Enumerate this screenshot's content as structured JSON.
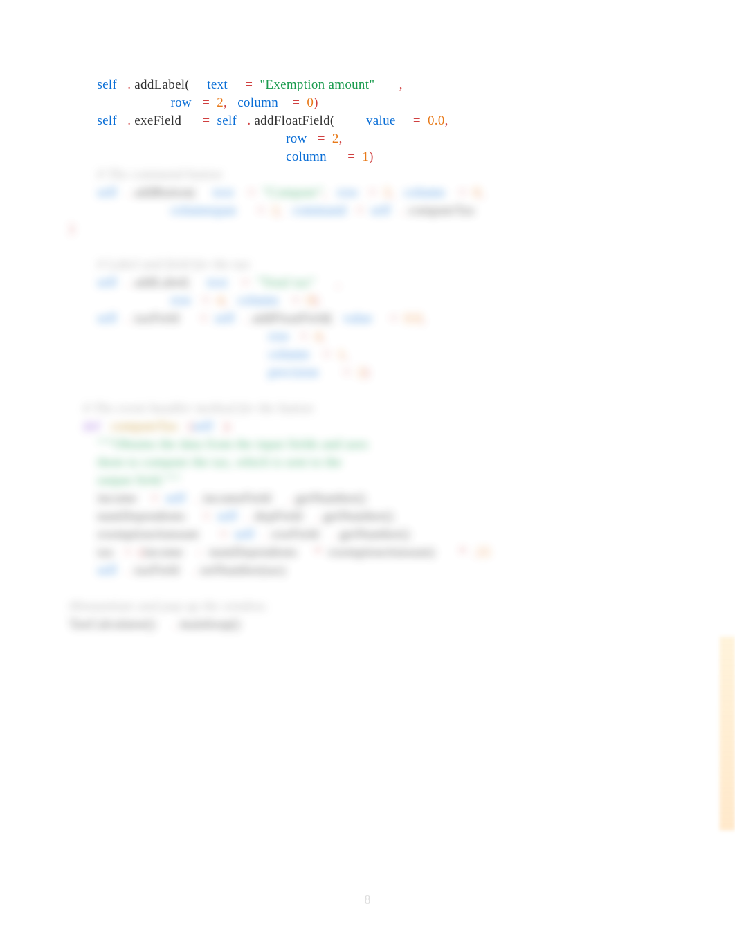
{
  "clear_lines": [
    {
      "indent": "        ",
      "tokens": [
        {
          "cls": "kw",
          "t": "self"
        },
        {
          "cls": "op",
          "t": "   . "
        },
        {
          "cls": "plain",
          "t": "addLabel("
        },
        {
          "cls": "plain",
          "t": "     "
        },
        {
          "cls": "kw",
          "t": "text"
        },
        {
          "cls": "plain",
          "t": "     "
        },
        {
          "cls": "op",
          "t": "=  "
        },
        {
          "cls": "str",
          "t": "\"Exemption amount\""
        },
        {
          "cls": "plain",
          "t": "       "
        },
        {
          "cls": "op",
          "t": ","
        }
      ]
    },
    {
      "indent": "                             ",
      "tokens": [
        {
          "cls": "kw",
          "t": "row"
        },
        {
          "cls": "plain",
          "t": "   "
        },
        {
          "cls": "op",
          "t": "=  "
        },
        {
          "cls": "num",
          "t": "2"
        },
        {
          "cls": "op",
          "t": ",   "
        },
        {
          "cls": "kw",
          "t": "column"
        },
        {
          "cls": "plain",
          "t": "    "
        },
        {
          "cls": "op",
          "t": "=  "
        },
        {
          "cls": "num",
          "t": "0"
        },
        {
          "cls": "op",
          "t": ")"
        }
      ]
    },
    {
      "indent": "        ",
      "tokens": [
        {
          "cls": "kw",
          "t": "self"
        },
        {
          "cls": "op",
          "t": "   . "
        },
        {
          "cls": "plain",
          "t": "exeField      "
        },
        {
          "cls": "op",
          "t": "=  "
        },
        {
          "cls": "kw",
          "t": "self"
        },
        {
          "cls": "op",
          "t": "   . "
        },
        {
          "cls": "plain",
          "t": "addFloatField("
        },
        {
          "cls": "plain",
          "t": "         "
        },
        {
          "cls": "kw",
          "t": "value"
        },
        {
          "cls": "plain",
          "t": "     "
        },
        {
          "cls": "op",
          "t": "=  "
        },
        {
          "cls": "num",
          "t": "0.0"
        },
        {
          "cls": "op",
          "t": ", "
        }
      ]
    },
    {
      "indent": "                                                              ",
      "tokens": [
        {
          "cls": "kw",
          "t": "row"
        },
        {
          "cls": "plain",
          "t": "   "
        },
        {
          "cls": "op",
          "t": "=  "
        },
        {
          "cls": "num",
          "t": "2"
        },
        {
          "cls": "op",
          "t": ","
        }
      ]
    },
    {
      "indent": "                                                              ",
      "tokens": [
        {
          "cls": "kw",
          "t": "column"
        },
        {
          "cls": "plain",
          "t": "      "
        },
        {
          "cls": "op",
          "t": "=  "
        },
        {
          "cls": "num",
          "t": "1"
        },
        {
          "cls": "op",
          "t": ")"
        }
      ]
    }
  ],
  "blur_lines": [
    {
      "indent": "        ",
      "tokens": [
        {
          "cls": "com",
          "t": "# The command button"
        }
      ]
    },
    {
      "indent": "        ",
      "tokens": [
        {
          "cls": "kw",
          "t": "self"
        },
        {
          "cls": "op",
          "t": "   . "
        },
        {
          "cls": "plain",
          "t": "addButton(     "
        },
        {
          "cls": "kw",
          "t": "text"
        },
        {
          "cls": "plain",
          "t": "    "
        },
        {
          "cls": "op",
          "t": "=  "
        },
        {
          "cls": "str",
          "t": "\"Compute\""
        },
        {
          "cls": "op",
          "t": ",   "
        },
        {
          "cls": "kw",
          "t": "row"
        },
        {
          "cls": "plain",
          "t": "   "
        },
        {
          "cls": "op",
          "t": "=  "
        },
        {
          "cls": "num",
          "t": "3"
        },
        {
          "cls": "op",
          "t": ",   "
        },
        {
          "cls": "kw",
          "t": "column"
        },
        {
          "cls": "plain",
          "t": "    "
        },
        {
          "cls": "op",
          "t": "=  "
        },
        {
          "cls": "num",
          "t": "0"
        },
        {
          "cls": "op",
          "t": ","
        }
      ]
    },
    {
      "indent": "                             ",
      "tokens": [
        {
          "cls": "kw",
          "t": "columnspan"
        },
        {
          "cls": "plain",
          "t": "      "
        },
        {
          "cls": "op",
          "t": "=  "
        },
        {
          "cls": "num",
          "t": "2"
        },
        {
          "cls": "op",
          "t": ",   "
        },
        {
          "cls": "kw",
          "t": "command"
        },
        {
          "cls": "plain",
          "t": "   "
        },
        {
          "cls": "op",
          "t": "=  "
        },
        {
          "cls": "kw",
          "t": "self"
        },
        {
          "cls": "op",
          "t": "   . "
        },
        {
          "cls": "plain",
          "t": "computeTax"
        }
      ]
    },
    {
      "indent": "",
      "tokens": [
        {
          "cls": "op",
          "t": ")"
        }
      ]
    },
    {
      "indent": "",
      "tokens": [
        {
          "cls": "plain",
          "t": " "
        }
      ]
    },
    {
      "indent": "        ",
      "tokens": [
        {
          "cls": "com",
          "t": "# Label and field for the tax"
        }
      ]
    },
    {
      "indent": "        ",
      "tokens": [
        {
          "cls": "kw",
          "t": "self"
        },
        {
          "cls": "op",
          "t": "   . "
        },
        {
          "cls": "plain",
          "t": "addLabel(     "
        },
        {
          "cls": "kw",
          "t": "text"
        },
        {
          "cls": "plain",
          "t": "    "
        },
        {
          "cls": "op",
          "t": "=  "
        },
        {
          "cls": "str",
          "t": "\"Total tax\""
        },
        {
          "cls": "plain",
          "t": "      "
        },
        {
          "cls": "op",
          "t": ","
        }
      ]
    },
    {
      "indent": "                             ",
      "tokens": [
        {
          "cls": "kw",
          "t": "row"
        },
        {
          "cls": "plain",
          "t": "   "
        },
        {
          "cls": "op",
          "t": "=  "
        },
        {
          "cls": "num",
          "t": "4"
        },
        {
          "cls": "op",
          "t": ",   "
        },
        {
          "cls": "kw",
          "t": "column"
        },
        {
          "cls": "plain",
          "t": "    "
        },
        {
          "cls": "op",
          "t": "=  "
        },
        {
          "cls": "num",
          "t": "0"
        },
        {
          "cls": "op",
          "t": ")"
        }
      ]
    },
    {
      "indent": "        ",
      "tokens": [
        {
          "cls": "kw",
          "t": "self"
        },
        {
          "cls": "op",
          "t": "   . "
        },
        {
          "cls": "plain",
          "t": "taxField      "
        },
        {
          "cls": "op",
          "t": "=  "
        },
        {
          "cls": "kw",
          "t": "self"
        },
        {
          "cls": "op",
          "t": "   . "
        },
        {
          "cls": "plain",
          "t": "addFloatField(   "
        },
        {
          "cls": "kw",
          "t": "value"
        },
        {
          "cls": "plain",
          "t": "     "
        },
        {
          "cls": "op",
          "t": "=  "
        },
        {
          "cls": "num",
          "t": "0.0"
        },
        {
          "cls": "op",
          "t": ", "
        }
      ]
    },
    {
      "indent": "                                                         ",
      "tokens": [
        {
          "cls": "kw",
          "t": "row"
        },
        {
          "cls": "plain",
          "t": "   "
        },
        {
          "cls": "op",
          "t": "=  "
        },
        {
          "cls": "num",
          "t": "4"
        },
        {
          "cls": "op",
          "t": ","
        }
      ]
    },
    {
      "indent": "                                                         ",
      "tokens": [
        {
          "cls": "kw",
          "t": "column"
        },
        {
          "cls": "plain",
          "t": "    "
        },
        {
          "cls": "op",
          "t": "=  "
        },
        {
          "cls": "num",
          "t": "1"
        },
        {
          "cls": "op",
          "t": ","
        }
      ]
    },
    {
      "indent": "                                                         ",
      "tokens": [
        {
          "cls": "kw",
          "t": "precision"
        },
        {
          "cls": "plain",
          "t": "       "
        },
        {
          "cls": "op",
          "t": "=  "
        },
        {
          "cls": "num",
          "t": "2"
        },
        {
          "cls": "op",
          "t": ")"
        }
      ]
    },
    {
      "indent": "",
      "tokens": [
        {
          "cls": "plain",
          "t": " "
        }
      ]
    },
    {
      "indent": "    ",
      "tokens": [
        {
          "cls": "com",
          "t": "# The event handler method for the button"
        }
      ]
    },
    {
      "indent": "    ",
      "tokens": [
        {
          "cls": "de",
          "t": "def"
        },
        {
          "cls": "plain",
          "t": "   "
        },
        {
          "cls": "fn",
          "t": "computeTax"
        },
        {
          "cls": "op",
          "t": "   ("
        },
        {
          "cls": "kw",
          "t": "self"
        },
        {
          "cls": "op",
          "t": "   ):"
        }
      ]
    },
    {
      "indent": "        ",
      "tokens": [
        {
          "cls": "doc",
          "t": "\"\"\"Obtains the data from the input fields and uses"
        }
      ]
    },
    {
      "indent": "        ",
      "tokens": [
        {
          "cls": "doc",
          "t": "them to compute the tax, which is sent to the"
        }
      ]
    },
    {
      "indent": "        ",
      "tokens": [
        {
          "cls": "doc",
          "t": "output field.\"\"\""
        }
      ]
    },
    {
      "indent": "        ",
      "tokens": [
        {
          "cls": "plain",
          "t": "income    "
        },
        {
          "cls": "op",
          "t": "=  "
        },
        {
          "cls": "kw",
          "t": "self"
        },
        {
          "cls": "op",
          "t": "   . "
        },
        {
          "cls": "plain",
          "t": "incomeField     "
        },
        {
          "cls": "op",
          "t": ". "
        },
        {
          "cls": "plain",
          "t": "getNumber()"
        }
      ]
    },
    {
      "indent": "        ",
      "tokens": [
        {
          "cls": "plain",
          "t": "numDependents     "
        },
        {
          "cls": "op",
          "t": "=  "
        },
        {
          "cls": "kw",
          "t": "self"
        },
        {
          "cls": "op",
          "t": "   . "
        },
        {
          "cls": "plain",
          "t": "depField    "
        },
        {
          "cls": "op",
          "t": ". "
        },
        {
          "cls": "plain",
          "t": "getNumber()"
        }
      ]
    },
    {
      "indent": "        ",
      "tokens": [
        {
          "cls": "plain",
          "t": "exemptionAmount      "
        },
        {
          "cls": "op",
          "t": "=  "
        },
        {
          "cls": "kw",
          "t": "self"
        },
        {
          "cls": "op",
          "t": "   . "
        },
        {
          "cls": "plain",
          "t": "exeField    "
        },
        {
          "cls": "op",
          "t": ". "
        },
        {
          "cls": "plain",
          "t": "getNumber()"
        }
      ]
    },
    {
      "indent": "        ",
      "tokens": [
        {
          "cls": "plain",
          "t": "tax   "
        },
        {
          "cls": "op",
          "t": "=  ("
        },
        {
          "cls": "plain",
          "t": "income    "
        },
        {
          "cls": "op",
          "t": "-  "
        },
        {
          "cls": "plain",
          "t": "numDependents     "
        },
        {
          "cls": "op",
          "t": "*  "
        },
        {
          "cls": "plain",
          "t": "exemptionAmount)       "
        },
        {
          "cls": "op",
          "t": "*  ."
        },
        {
          "cls": "num",
          "t": "15"
        }
      ]
    },
    {
      "indent": "        ",
      "tokens": [
        {
          "cls": "kw",
          "t": "self"
        },
        {
          "cls": "op",
          "t": "   . "
        },
        {
          "cls": "plain",
          "t": "taxField    "
        },
        {
          "cls": "op",
          "t": ". "
        },
        {
          "cls": "plain",
          "t": "setNumber(tax)"
        }
      ]
    },
    {
      "indent": "",
      "tokens": [
        {
          "cls": "plain",
          "t": " "
        }
      ]
    },
    {
      "indent": "",
      "tokens": [
        {
          "cls": "com",
          "t": "#Instantiate and pop up the window."
        }
      ]
    },
    {
      "indent": "",
      "tokens": [
        {
          "cls": "plain",
          "t": "TaxCalculator()     "
        },
        {
          "cls": "op",
          "t": ". "
        },
        {
          "cls": "plain",
          "t": "mainloop()"
        }
      ]
    }
  ],
  "page_number": "8"
}
